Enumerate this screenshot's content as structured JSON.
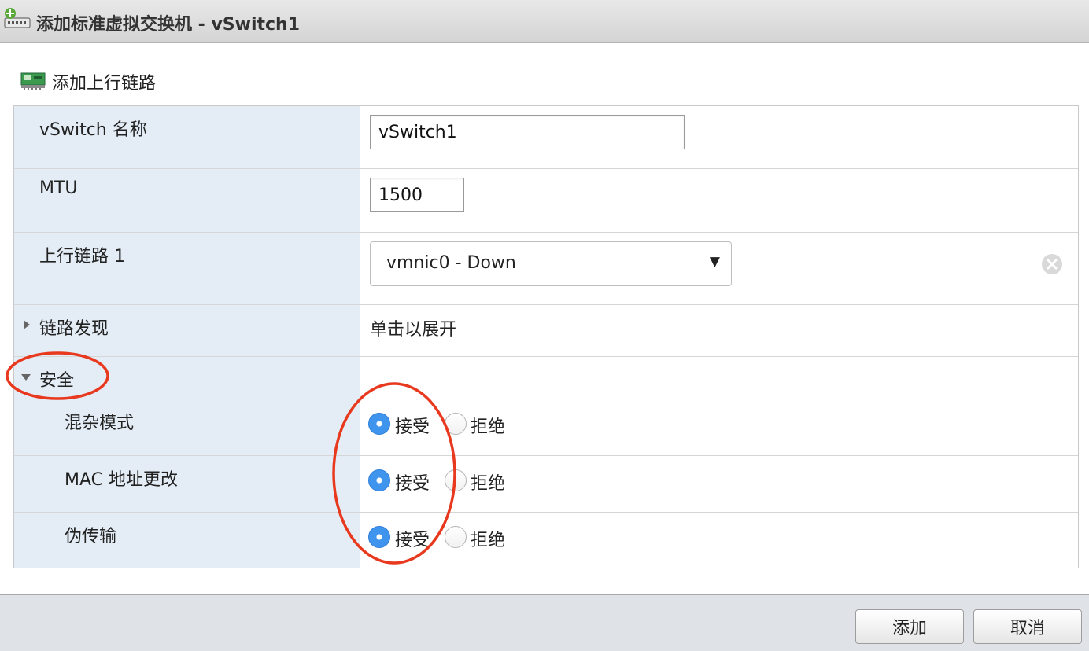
{
  "dialog": {
    "title": "添加标准虚拟交换机 - vSwitch1",
    "add_uplink_label": "添加上行链路"
  },
  "form": {
    "vswitch_name": {
      "label": "vSwitch 名称",
      "value": "vSwitch1"
    },
    "mtu": {
      "label": "MTU",
      "value": "1500"
    },
    "uplink1": {
      "label": "上行链路 1",
      "selected": "vmnic0 - Down"
    },
    "link_discovery": {
      "label": "链路发现",
      "hint": "单击以展开"
    },
    "security": {
      "label": "安全",
      "accept_label": "接受",
      "reject_label": "拒绝",
      "promiscuous": {
        "label": "混杂模式",
        "value": "接受"
      },
      "mac_change": {
        "label": "MAC 地址更改",
        "value": "接受"
      },
      "forged_transmits": {
        "label": "伪传输",
        "value": "接受"
      }
    }
  },
  "footer": {
    "add_button": "添加",
    "cancel_button": "取消"
  },
  "colors": {
    "label_bg": "#e4edf5",
    "radio_selected": "#3f95ee",
    "annotation": "#e8391f",
    "footer_bg": "#dfe2e6"
  },
  "icons": [
    "add-vswitch-icon",
    "nic-icon",
    "remove-icon",
    "expand-caret-icon",
    "collapse-caret-icon",
    "dropdown-arrow-icon"
  ]
}
